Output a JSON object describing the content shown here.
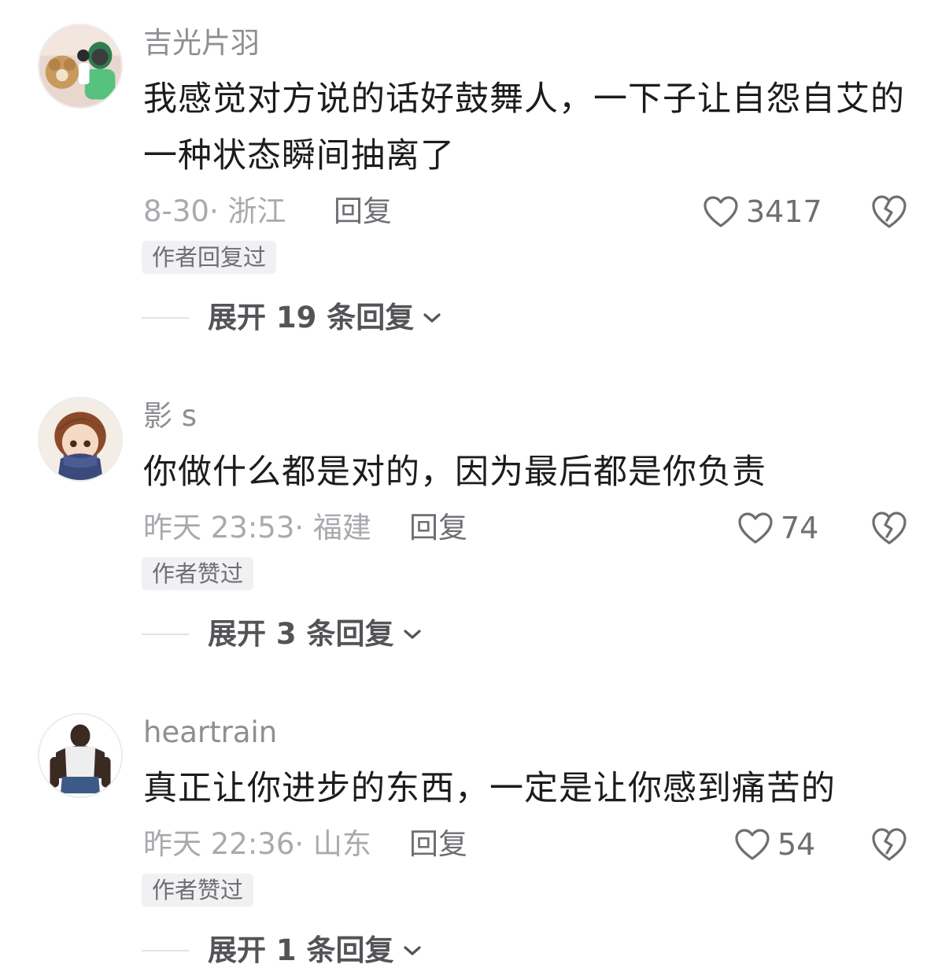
{
  "comments": [
    {
      "username": "吉光片羽",
      "content": "我感觉对方说的话好鼓舞人，一下子让自怨自艾的一种状态瞬间抽离了",
      "meta": "8-30· 浙江",
      "reply_label": "回复",
      "likes": "3417",
      "badge": "作者回复过",
      "expand_label": "展开 19 条回复"
    },
    {
      "username": "影 s",
      "content": "你做什么都是对的，因为最后都是你负责",
      "meta": "昨天 23:53· 福建",
      "reply_label": "回复",
      "likes": "74",
      "badge": "作者赞过",
      "expand_label": "展开 3 条回复"
    },
    {
      "username": "heartrain",
      "content": "真正让你进步的东西，一定是让你感到痛苦的",
      "meta": "昨天 22:36· 山东",
      "reply_label": "回复",
      "likes": "54",
      "badge": "作者赞过",
      "expand_label": "展开 1 条回复"
    }
  ],
  "icons": {
    "like": "heart-outline-icon",
    "dislike": "broken-heart-icon",
    "expand": "chevron-down-icon"
  },
  "colors": {
    "username": "#8e8e93",
    "content": "#1c1c1e",
    "meta": "#a9a9ae",
    "badge_bg": "#f1f1f3"
  }
}
